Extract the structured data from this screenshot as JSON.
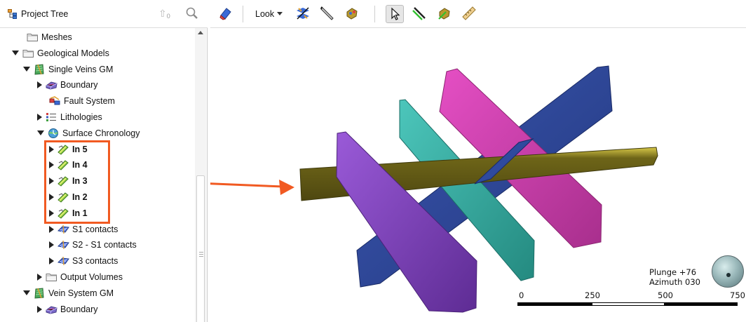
{
  "tree": {
    "title": "Project Tree",
    "header_count": "0",
    "items": [
      {
        "label": "Meshes",
        "icon": "folder-icon",
        "depth": 1,
        "expander": "none",
        "bold": false
      },
      {
        "label": "Geological Models",
        "icon": "folder-icon",
        "depth": 0,
        "expander": "open",
        "bold": false
      },
      {
        "label": "Single Veins GM",
        "icon": "geological-model-icon",
        "depth": 1,
        "expander": "open",
        "bold": false
      },
      {
        "label": "Boundary",
        "icon": "boundary-icon",
        "depth": 2,
        "expander": "closed",
        "bold": false
      },
      {
        "label": "Fault System",
        "icon": "fault-system-icon",
        "depth": 2,
        "expander": "none",
        "bold": false
      },
      {
        "label": "Lithologies",
        "icon": "lithologies-icon",
        "depth": 2,
        "expander": "closed",
        "bold": false
      },
      {
        "label": "Surface Chronology",
        "icon": "surface-chronology-icon",
        "depth": 2,
        "expander": "open",
        "bold": false
      },
      {
        "label": "In 5",
        "icon": "vein-icon",
        "depth": 3,
        "expander": "closed",
        "bold": true
      },
      {
        "label": "In 4",
        "icon": "vein-icon",
        "depth": 3,
        "expander": "closed",
        "bold": true
      },
      {
        "label": "In 3",
        "icon": "vein-icon",
        "depth": 3,
        "expander": "closed",
        "bold": true
      },
      {
        "label": "In 2",
        "icon": "vein-icon",
        "depth": 3,
        "expander": "closed",
        "bold": true
      },
      {
        "label": "In 1",
        "icon": "vein-icon",
        "depth": 3,
        "expander": "closed",
        "bold": true
      },
      {
        "label": "S1 contacts",
        "icon": "contacts-icon",
        "depth": 3,
        "expander": "closed",
        "bold": false
      },
      {
        "label": "S2 - S1 contacts",
        "icon": "contacts-icon",
        "depth": 3,
        "expander": "closed",
        "bold": false
      },
      {
        "label": "S3 contacts",
        "icon": "contacts-icon",
        "depth": 3,
        "expander": "closed",
        "bold": false
      },
      {
        "label": "Output Volumes",
        "icon": "folder-icon",
        "depth": 2,
        "expander": "closed",
        "bold": false
      },
      {
        "label": "Vein System GM",
        "icon": "geological-model-icon",
        "depth": 1,
        "expander": "open",
        "bold": false
      },
      {
        "label": "Boundary",
        "icon": "boundary-icon",
        "depth": 2,
        "expander": "closed",
        "bold": false
      }
    ]
  },
  "toolbar": {
    "look_label": "Look",
    "buttons": [
      {
        "name": "eraser-icon"
      },
      {
        "name": "draw-slicer-icon"
      },
      {
        "name": "slice-knife-icon"
      },
      {
        "name": "move-object-icon"
      },
      {
        "name": "select-pointer-icon"
      },
      {
        "name": "draw-line-icon"
      },
      {
        "name": "edit-object-icon"
      },
      {
        "name": "ruler-icon"
      }
    ]
  },
  "viewer": {
    "plunge": "Plunge +76",
    "azimuth": "Azimuth 030",
    "scale_labels": [
      "0",
      "250",
      "500",
      "750"
    ]
  },
  "colors": {
    "highlight": "#f15a22",
    "vein_yellow": "#6b6218",
    "vein_purple": "#7a3fb8",
    "vein_teal": "#3bb3a8",
    "vein_blue": "#2f4a9e",
    "vein_pink": "#d03fb0"
  }
}
